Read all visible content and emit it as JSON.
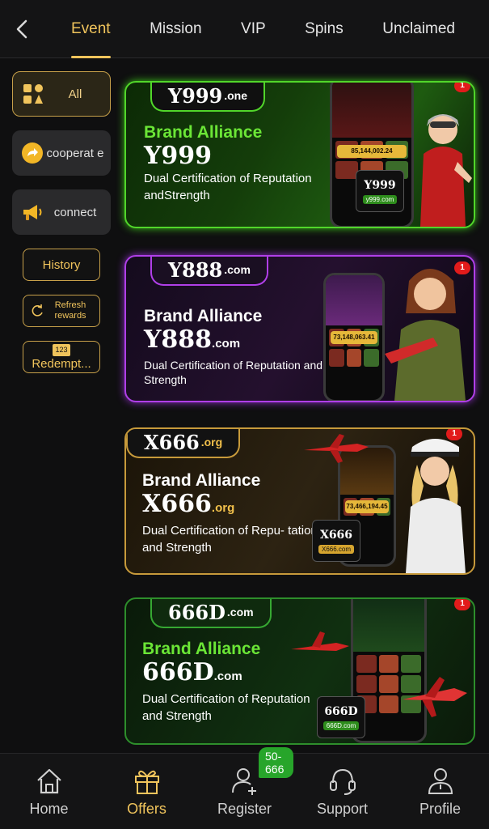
{
  "header": {
    "tabs": [
      {
        "label": "Event",
        "active": true
      },
      {
        "label": "Mission"
      },
      {
        "label": "VIP"
      },
      {
        "label": "Spins"
      },
      {
        "label": "Unclaimed"
      }
    ]
  },
  "sidebar": {
    "categories": [
      {
        "label": "All",
        "icon": "grid-icon",
        "active": true
      },
      {
        "label": "cooperat e",
        "icon": "share-arrow-icon"
      },
      {
        "label": "connect",
        "icon": "megaphone-icon"
      }
    ],
    "history_label": "History",
    "refresh_label": "Refresh rewards",
    "redeem_label": "Redempt...",
    "redeem_code": "123"
  },
  "banners": [
    {
      "logo_main": "Y999",
      "logo_suffix": ".one",
      "brand_alliance": "Brand Alliance",
      "brand": "Y999",
      "brand_suffix": "",
      "dual": "Dual Certification of Reputation andStrength",
      "stamp": "Y999",
      "stamp_url": "y999.com",
      "badge": "1",
      "jackpot": "85,144,002.24",
      "accent": "#51d62a"
    },
    {
      "logo_main": "Y888",
      "logo_suffix": ".com",
      "brand_alliance": "Brand Alliance",
      "brand": "Y888",
      "brand_suffix": ".com",
      "dual": "Dual Certification of Reputation and Strength",
      "stamp": "",
      "stamp_url": "",
      "badge": "1",
      "jackpot": "73,148,063.41",
      "accent": "#b03fe8"
    },
    {
      "logo_main": "X666",
      "logo_suffix": ".org",
      "brand_alliance": "Brand Alliance",
      "brand": "X666",
      "brand_suffix": ".org",
      "dual": "Dual Certification of Repu- tation and Strength",
      "stamp": "X666",
      "stamp_url": "X666.com",
      "badge": "1",
      "jackpot": "73,466,194.45",
      "accent": "#c79a3b"
    },
    {
      "logo_main": "666D",
      "logo_suffix": ".com",
      "brand_alliance": "Brand Alliance",
      "brand": "666D",
      "brand_suffix": ".com",
      "dual": "Dual Certification of Reputation and Strength",
      "stamp": "666D",
      "stamp_url": "666D.com",
      "badge": "1",
      "jackpot": "",
      "accent": "#2d8e2b"
    }
  ],
  "bottomnav": {
    "items": [
      {
        "label": "Home",
        "icon": "home-icon"
      },
      {
        "label": "Offers",
        "icon": "gift-icon",
        "active": true
      },
      {
        "label": "Register",
        "icon": "add-user-icon"
      },
      {
        "label": "Support",
        "icon": "headset-icon"
      },
      {
        "label": "Profile",
        "icon": "person-icon"
      }
    ],
    "register_badge": "50-666"
  },
  "colors": {
    "accent": "#f0c45c",
    "background": "#0f0f10",
    "badge": "#e21b1b"
  }
}
